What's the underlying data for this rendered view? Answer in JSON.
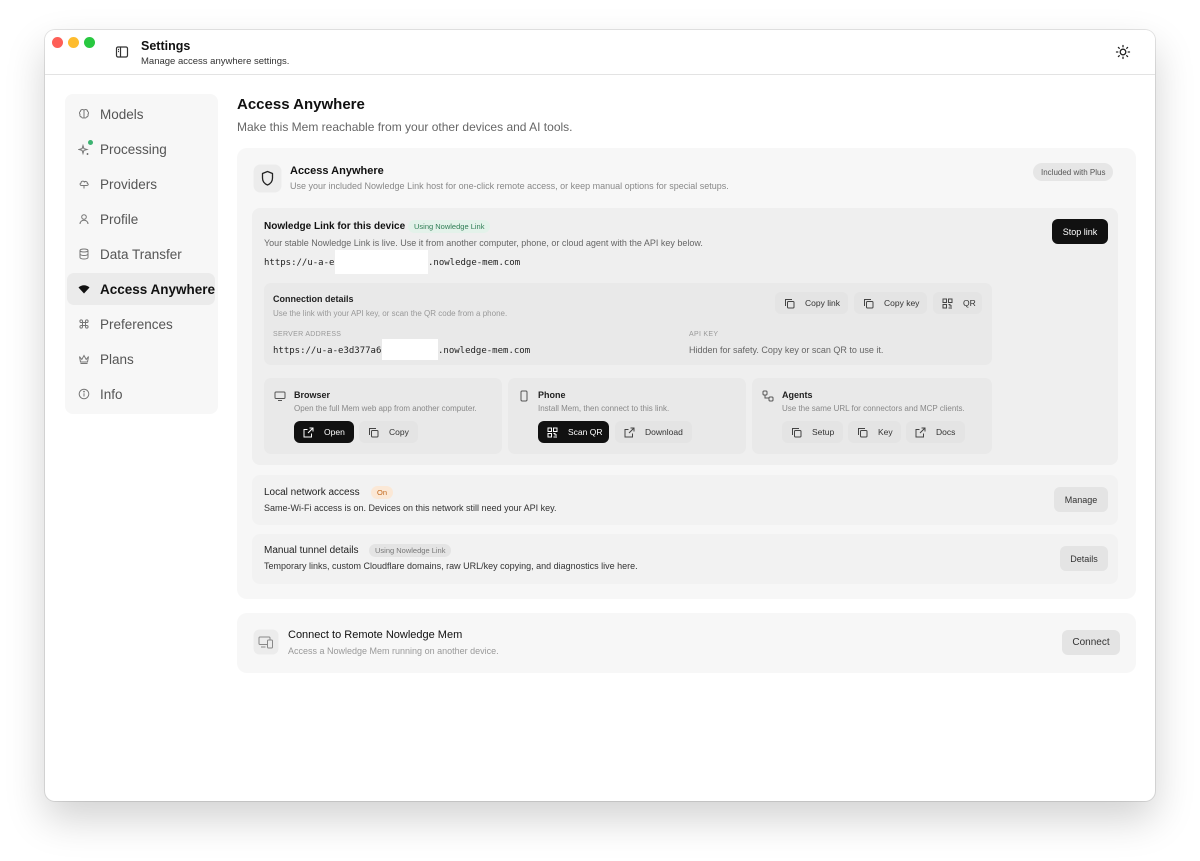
{
  "titlebar": {
    "title": "Settings",
    "subtitle": "Manage access anywhere settings."
  },
  "sidebar": {
    "items": [
      {
        "label": "Models",
        "icon": "brain-icon",
        "active": false
      },
      {
        "label": "Processing",
        "icon": "sparkle-icon",
        "active": false
      },
      {
        "label": "Providers",
        "icon": "cloud-icon",
        "active": false
      },
      {
        "label": "Profile",
        "icon": "user-icon",
        "active": false
      },
      {
        "label": "Data Transfer",
        "icon": "database-icon",
        "active": false
      },
      {
        "label": "Access Anywhere",
        "icon": "wifi-icon",
        "active": true
      },
      {
        "label": "Preferences",
        "icon": "command-icon",
        "active": false
      },
      {
        "label": "Plans",
        "icon": "crown-icon",
        "active": false
      },
      {
        "label": "Info",
        "icon": "info-icon",
        "active": false
      }
    ]
  },
  "page": {
    "title": "Access Anywhere",
    "subtitle": "Make this Mem reachable from your other devices and AI tools."
  },
  "access_card": {
    "title": "Access Anywhere",
    "description": "Use your included Nowledge Link host for one-click remote access, or keep manual options for special setups.",
    "badge": "Included with Plus"
  },
  "link": {
    "title": "Nowledge Link for this device",
    "badge": "Using Nowledge Link",
    "description": "Your stable Nowledge Link is live. Use it from another computer, phone, or cloud agent with the API key below.",
    "url_prefix": "https://u-a-e",
    "url_suffix": ".nowledge-mem.com",
    "stop_label": "Stop link"
  },
  "connection": {
    "title": "Connection details",
    "description": "Use the link with your API key, or scan the QR code from a phone.",
    "copy_link": "Copy link",
    "copy_key": "Copy key",
    "qr": "QR",
    "server_label": "SERVER ADDRESS",
    "server_prefix": "https://u-a-e3d377a6",
    "server_suffix": ".nowledge-mem.com",
    "api_label": "API KEY",
    "api_value": "Hidden for safety. Copy key or scan QR to use it."
  },
  "tiles": {
    "browser": {
      "title": "Browser",
      "description": "Open the full Mem web app from another computer.",
      "open": "Open",
      "copy": "Copy"
    },
    "phone": {
      "title": "Phone",
      "description": "Install Mem, then connect to this link.",
      "scan": "Scan QR",
      "download": "Download"
    },
    "agents": {
      "title": "Agents",
      "description": "Use the same URL for connectors and MCP clients.",
      "setup": "Setup",
      "key": "Key",
      "docs": "Docs"
    }
  },
  "local": {
    "title": "Local network access",
    "badge": "On",
    "description": "Same-Wi-Fi access is on. Devices on this network still need your API key.",
    "button": "Manage"
  },
  "tunnel": {
    "title": "Manual tunnel details",
    "badge": "Using Nowledge Link",
    "description": "Temporary links, custom Cloudflare domains, raw URL/key copying, and diagnostics live here.",
    "button": "Details"
  },
  "remote": {
    "title": "Connect to Remote Nowledge Mem",
    "description": "Access a Nowledge Mem running on another device.",
    "button": "Connect"
  },
  "colors": {
    "accent_dark": "#111111",
    "badge_green_bg": "#e3f2ea",
    "badge_green_text": "#2e7d54",
    "badge_orange_bg": "#fbe8d6",
    "badge_orange_text": "#c2671b",
    "status_dot": "#3cb371"
  }
}
